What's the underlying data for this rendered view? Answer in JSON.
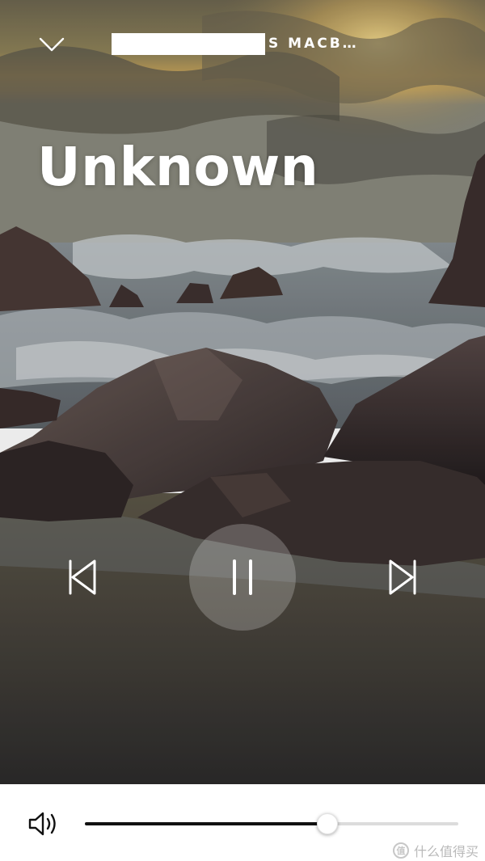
{
  "player": {
    "device_name": "S MACB…",
    "track_title": "Unknown",
    "state": "playing"
  },
  "controls": {
    "collapse_icon": "chevron-down-icon",
    "previous_icon": "skip-previous-icon",
    "pause_icon": "pause-icon",
    "next_icon": "skip-next-icon",
    "volume_icon": "speaker-volume-icon"
  },
  "volume": {
    "level_fraction": 0.65
  },
  "watermark": {
    "text": "什么值得买",
    "badge_char": "值"
  },
  "colors": {
    "accent": "#111111",
    "control_white": "#ffffff",
    "track_inactive": "#dcdcdc"
  }
}
